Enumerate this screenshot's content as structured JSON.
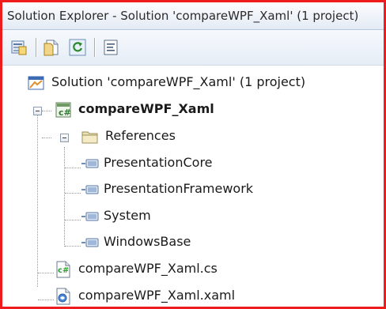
{
  "title": "Solution Explorer - Solution 'compareWPF_Xaml' (1 project)",
  "toolbar": {
    "buttons": [
      {
        "name": "properties-button",
        "icon": "properties-icon"
      },
      {
        "name": "show-all-files-button",
        "icon": "show-all-files-icon"
      },
      {
        "name": "refresh-button",
        "icon": "refresh-icon"
      },
      {
        "name": "view-code-button",
        "icon": "view-code-icon"
      }
    ]
  },
  "tree": {
    "solution": {
      "label": "Solution 'compareWPF_Xaml' (1 project)",
      "icon": "solution-icon"
    },
    "project": {
      "label": "compareWPF_Xaml",
      "icon": "csharp-project-icon"
    },
    "references": {
      "label": "References",
      "icon": "folder-icon",
      "items": [
        {
          "label": "PresentationCore",
          "icon": "reference-icon"
        },
        {
          "label": "PresentationFramework",
          "icon": "reference-icon"
        },
        {
          "label": "System",
          "icon": "reference-icon"
        },
        {
          "label": "WindowsBase",
          "icon": "reference-icon"
        }
      ]
    },
    "files": [
      {
        "label": "compareWPF_Xaml.cs",
        "icon": "csharp-file-icon"
      },
      {
        "label": "compareWPF_Xaml.xaml",
        "icon": "xaml-file-icon"
      }
    ]
  },
  "colors": {
    "frame_border": "#ee1c1c",
    "csharp_green": "#2f9e2f",
    "folder_fill": "#e9e1b6"
  }
}
